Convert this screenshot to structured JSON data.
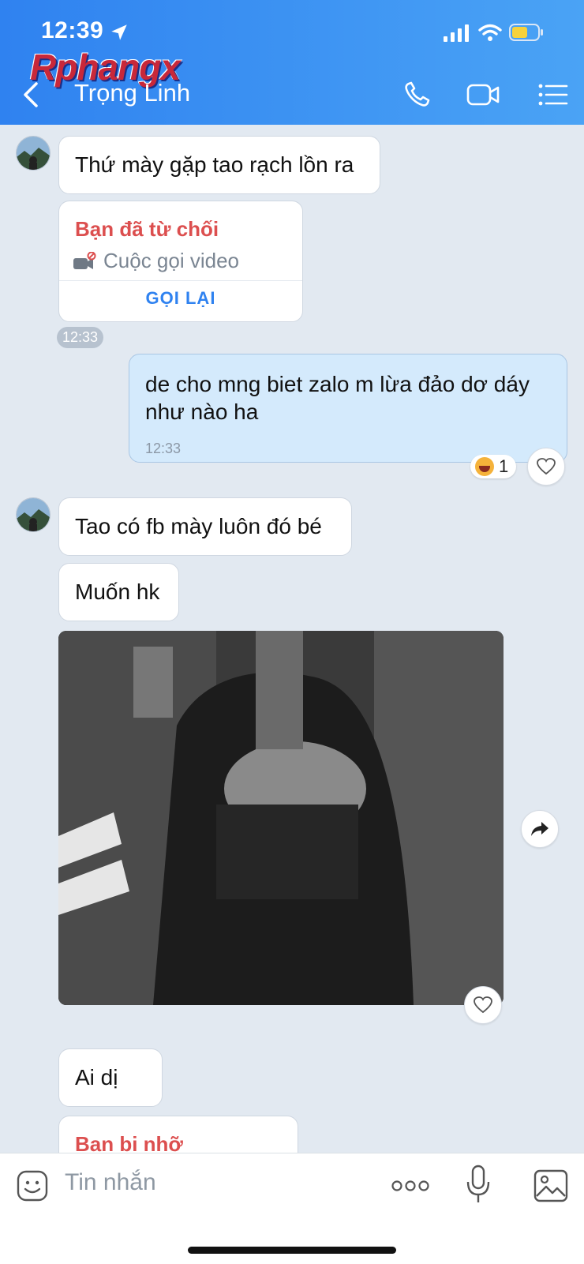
{
  "status_bar": {
    "time": "12:39"
  },
  "watermark": "Rphangx",
  "header": {
    "contact_name": "Trọng Linh"
  },
  "icons": {
    "location": "location-arrow-icon",
    "signal": "signal-icon",
    "wifi": "wifi-icon",
    "battery": "battery-icon",
    "back": "back-chevron-icon",
    "call": "phone-icon",
    "video": "video-camera-icon",
    "menu": "list-menu-icon",
    "sticker": "sticker-icon",
    "more": "more-dots-icon",
    "mic": "microphone-icon",
    "gallery": "image-icon"
  },
  "colors": {
    "header_blue": "#2f82f0",
    "missed_red": "#dc4f4f",
    "link_blue": "#2f82f0",
    "outgoing_bubble": "#d4eafc"
  },
  "messages": {
    "m1": "Thứ mày gặp tao rạch lồn ra",
    "call1": {
      "status": "Bạn đã từ chối",
      "type": "Cuộc gọi video",
      "action": "GỌI LẠI"
    },
    "t1": "12:33",
    "m2": {
      "text": "de cho mng biet zalo m lừa đảo dơ dáy như nào ha",
      "time": "12:33",
      "reaction_count": "1"
    },
    "m3": "Tao có fb mày luôn đó bé",
    "m4": "Muốn hk",
    "photo_label": "Ảnh",
    "m5": "Ai dị",
    "call2": {
      "status": "Bạn bị nhỡ"
    }
  },
  "input": {
    "placeholder": "Tin nhắn"
  }
}
